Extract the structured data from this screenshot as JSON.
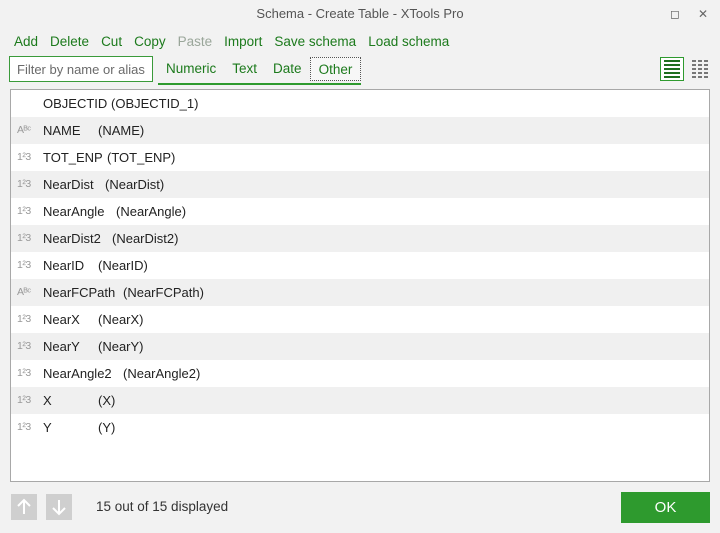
{
  "window": {
    "title": "Schema - Create Table - XTools Pro",
    "maximize_glyph": "◻",
    "close_glyph": "✕"
  },
  "toolbar": {
    "add": "Add",
    "delete": "Delete",
    "cut": "Cut",
    "copy": "Copy",
    "paste": "Paste",
    "import": "Import",
    "save_schema": "Save schema",
    "load_schema": "Load schema"
  },
  "filter": {
    "placeholder": "Filter by name or alias",
    "value": ""
  },
  "filter_tabs": [
    {
      "label": "Numeric"
    },
    {
      "label": "Text"
    },
    {
      "label": "Date"
    },
    {
      "label": "Other",
      "active": true
    }
  ],
  "view_modes": {
    "list": "list-view-icon",
    "grid": "grid-view-icon",
    "selected": "list"
  },
  "fields": [
    {
      "name": "OBJECTID",
      "alias": "(OBJECTID_1)",
      "type_icon": ""
    },
    {
      "name": "NAME",
      "alias": "(NAME)",
      "type_icon": "Aᴮᶜ"
    },
    {
      "name": "TOT_ENP",
      "alias": "(TOT_ENP)",
      "type_icon": "1²3"
    },
    {
      "name": "NearDist",
      "alias": "(NearDist)",
      "type_icon": "1²3"
    },
    {
      "name": "NearAngle",
      "alias": "(NearAngle)",
      "type_icon": "1²3"
    },
    {
      "name": "NearDist2",
      "alias": "(NearDist2)",
      "type_icon": "1²3"
    },
    {
      "name": "NearID",
      "alias": "(NearID)",
      "type_icon": "1²3"
    },
    {
      "name": "NearFCPath",
      "alias": "(NearFCPath)",
      "type_icon": "Aᴮᶜ"
    },
    {
      "name": "NearX",
      "alias": "(NearX)",
      "type_icon": "1²3"
    },
    {
      "name": "NearY",
      "alias": "(NearY)",
      "type_icon": "1²3"
    },
    {
      "name": "NearAngle2",
      "alias": "(NearAngle2)",
      "type_icon": "1²3"
    },
    {
      "name": "X",
      "alias": "(X)",
      "type_icon": "1²3"
    },
    {
      "name": "Y",
      "alias": "(Y)",
      "type_icon": "1²3"
    }
  ],
  "footer": {
    "status": "15 out of 15 displayed",
    "ok": "OK"
  },
  "colors": {
    "accent": "#2e9a2e",
    "link": "#1c7a1c",
    "disabled": "#9aa69a"
  }
}
